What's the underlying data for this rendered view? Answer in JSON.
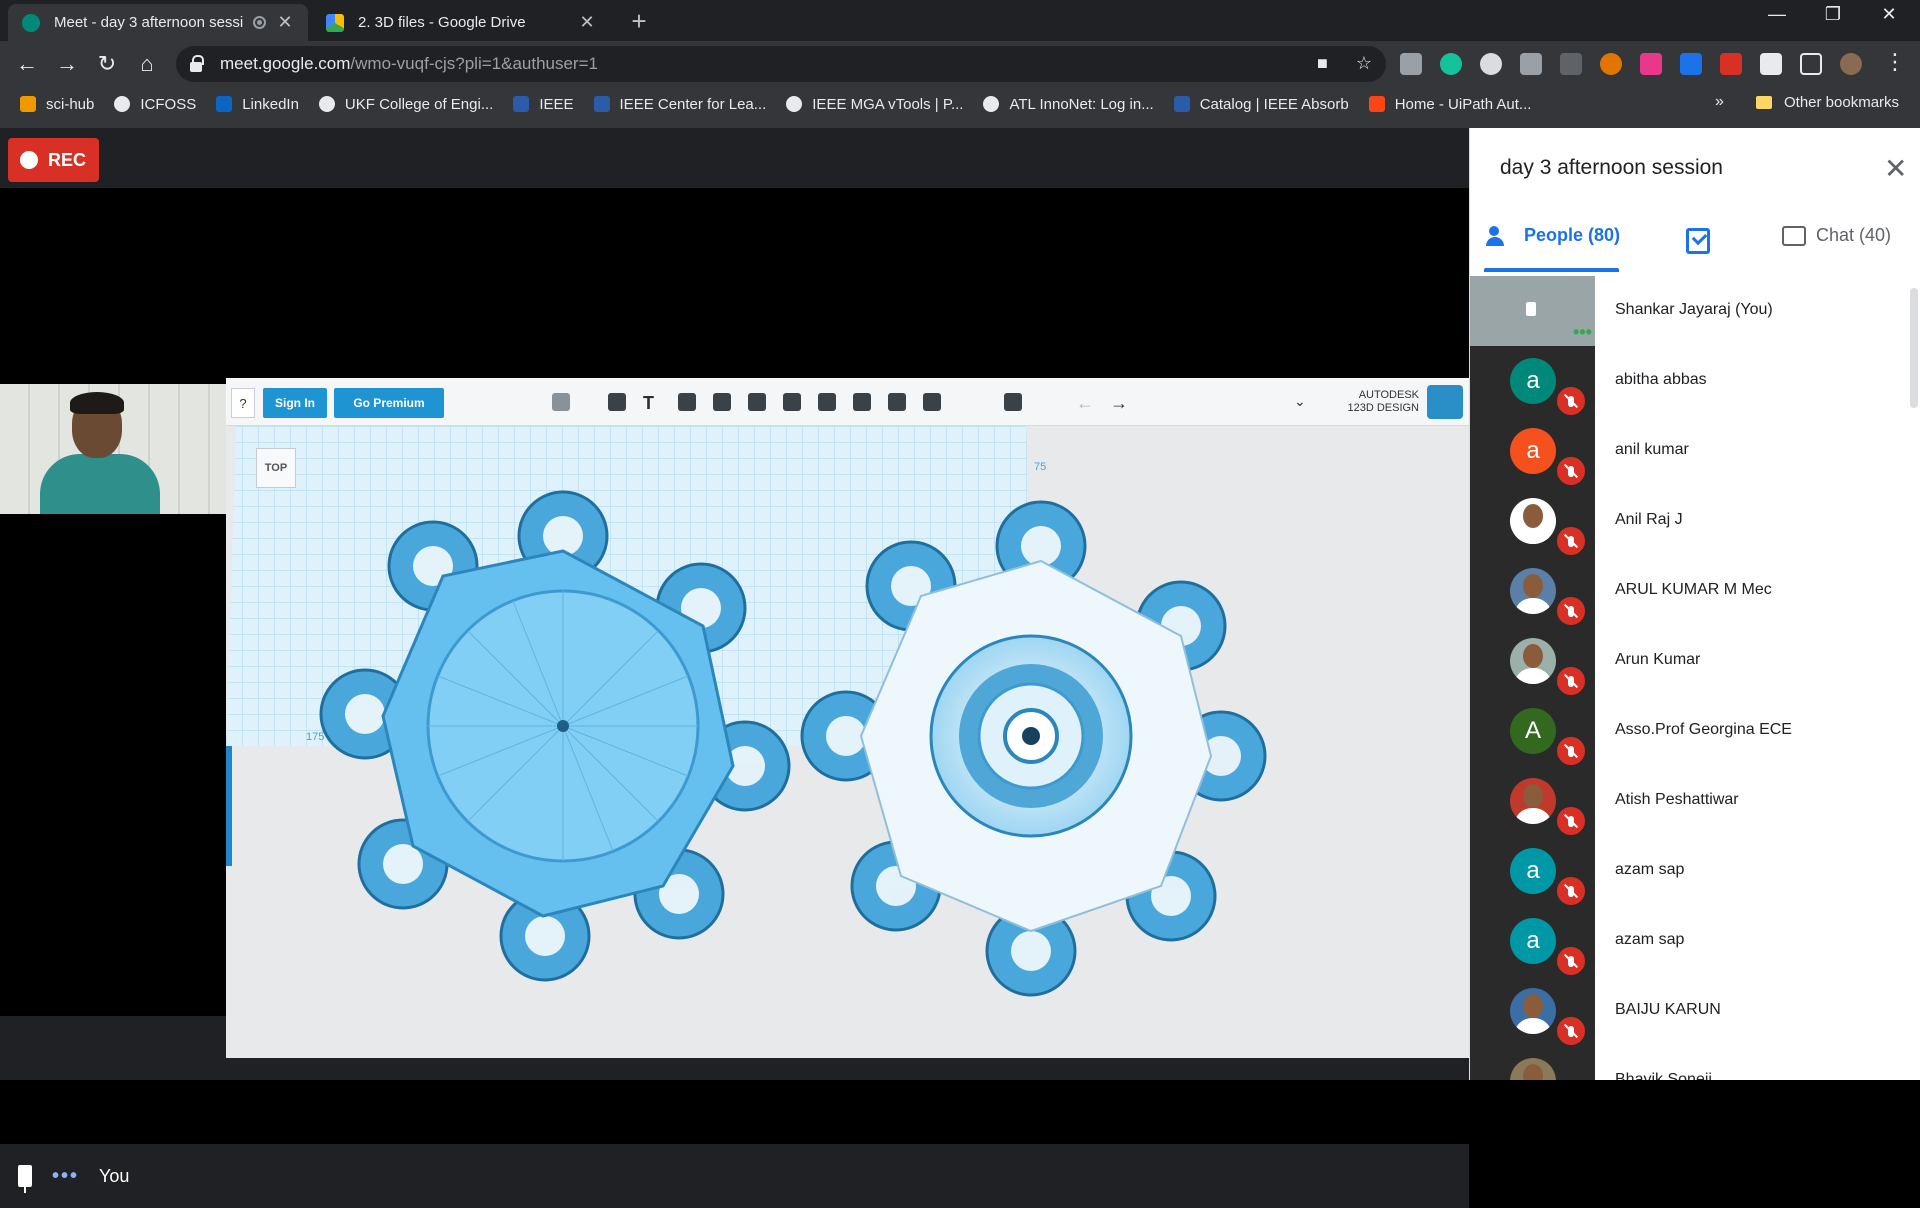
{
  "browser": {
    "tabs": [
      {
        "title": "Meet - day 3 afternoon sessi",
        "active": true
      },
      {
        "title": "2. 3D files - Google Drive",
        "active": false
      }
    ],
    "new_tab": "+",
    "window_controls": {
      "minimize": "—",
      "restore": "❐",
      "close": "✕"
    },
    "url_host": "meet.google.com",
    "url_path": "/wmo-vuqf-cjs?pli=1&authuser=1",
    "bookmarks": [
      "sci-hub",
      "ICFOSS",
      "LinkedIn",
      "UKF College of Engi...",
      "IEEE",
      "IEEE Center for Lea...",
      "IEEE MGA vTools | P...",
      "ATL InnoNet: Log in...",
      "Catalog | IEEE Absorb",
      "Home - UiPath Aut..."
    ],
    "bookmarks_overflow": "»",
    "other_bookmarks": "Other bookmarks"
  },
  "meet": {
    "rec_label": "REC",
    "self_label": "You",
    "panel": {
      "title": "day 3 afternoon session",
      "people_tab": "People (80)",
      "chat_tab": "Chat (40)",
      "participants": [
        {
          "name": "Shankar Jayaraj (You)",
          "avatar": "self",
          "color": "#9aa5a8"
        },
        {
          "name": "abitha abbas",
          "avatar": "a",
          "color": "#00897b"
        },
        {
          "name": "anil kumar",
          "avatar": "a",
          "color": "#f4511e"
        },
        {
          "name": "Anil Raj J",
          "avatar": "photo",
          "color": "#ffffff"
        },
        {
          "name": "ARUL KUMAR M Mec",
          "avatar": "photo",
          "color": "#5b7fa6"
        },
        {
          "name": "Arun Kumar",
          "avatar": "photo",
          "color": "#9ab0a8"
        },
        {
          "name": "Asso.Prof Georgina ECE",
          "avatar": "A",
          "color": "#33691e"
        },
        {
          "name": "Atish Peshattiwar",
          "avatar": "photo",
          "color": "#c0392b"
        },
        {
          "name": "azam sap",
          "avatar": "a",
          "color": "#0097a7"
        },
        {
          "name": "azam sap",
          "avatar": "a",
          "color": "#0097a7"
        },
        {
          "name": "BAIJU KARUN",
          "avatar": "photo",
          "color": "#3b6ea5"
        },
        {
          "name": "Bhavik Soneji",
          "avatar": "photo",
          "color": "#8a7a5a"
        }
      ]
    }
  },
  "shared_app": {
    "sign_in": "Sign In",
    "go_premium": "Go Premium",
    "help": "?",
    "logo_text_1": "AUTODESK",
    "logo_text_2": "123D DESIGN",
    "view_cube": "TOP",
    "grid_labels": [
      "75",
      "175",
      "75"
    ]
  },
  "colors": {
    "accent": "#1a73e8",
    "rec": "#d93025",
    "part_blue": "#55b4e8"
  }
}
